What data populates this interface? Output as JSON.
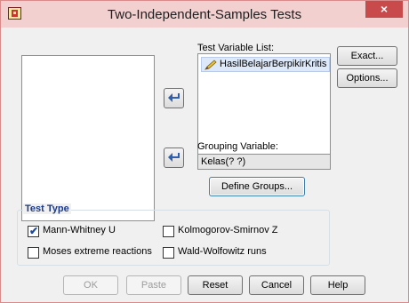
{
  "window": {
    "title": "Two-Independent-Samples Tests",
    "close_glyph": "×"
  },
  "labels": {
    "test_variable_list": "Test Variable List:",
    "grouping_variable": "Grouping Variable:"
  },
  "test_variables": [
    "HasilBelajarBerpikirKritis"
  ],
  "grouping": {
    "value": "Kelas(? ?)"
  },
  "buttons": {
    "exact": "Exact...",
    "options": "Options...",
    "define_groups": "Define Groups...",
    "ok": "OK",
    "paste": "Paste",
    "reset": "Reset",
    "cancel": "Cancel",
    "help": "Help"
  },
  "test_type": {
    "title": "Test Type",
    "options": [
      {
        "label": "Mann-Whitney U",
        "checked": true
      },
      {
        "label": "Kolmogorov-Smirnov Z",
        "checked": false
      },
      {
        "label": "Moses extreme reactions",
        "checked": false
      },
      {
        "label": "Wald-Wolfowitz runs",
        "checked": false
      }
    ]
  },
  "colors": {
    "title_bar": "#f2d0d0",
    "close_button": "#c94a4a",
    "group_title": "#1a3b8a",
    "selected_item": "#dde8f8"
  },
  "icons": {
    "app": "spss-app-icon",
    "arrow": "move-right-arrow-icon",
    "variable": "scale-variable-pencil-icon",
    "close": "close-icon"
  }
}
